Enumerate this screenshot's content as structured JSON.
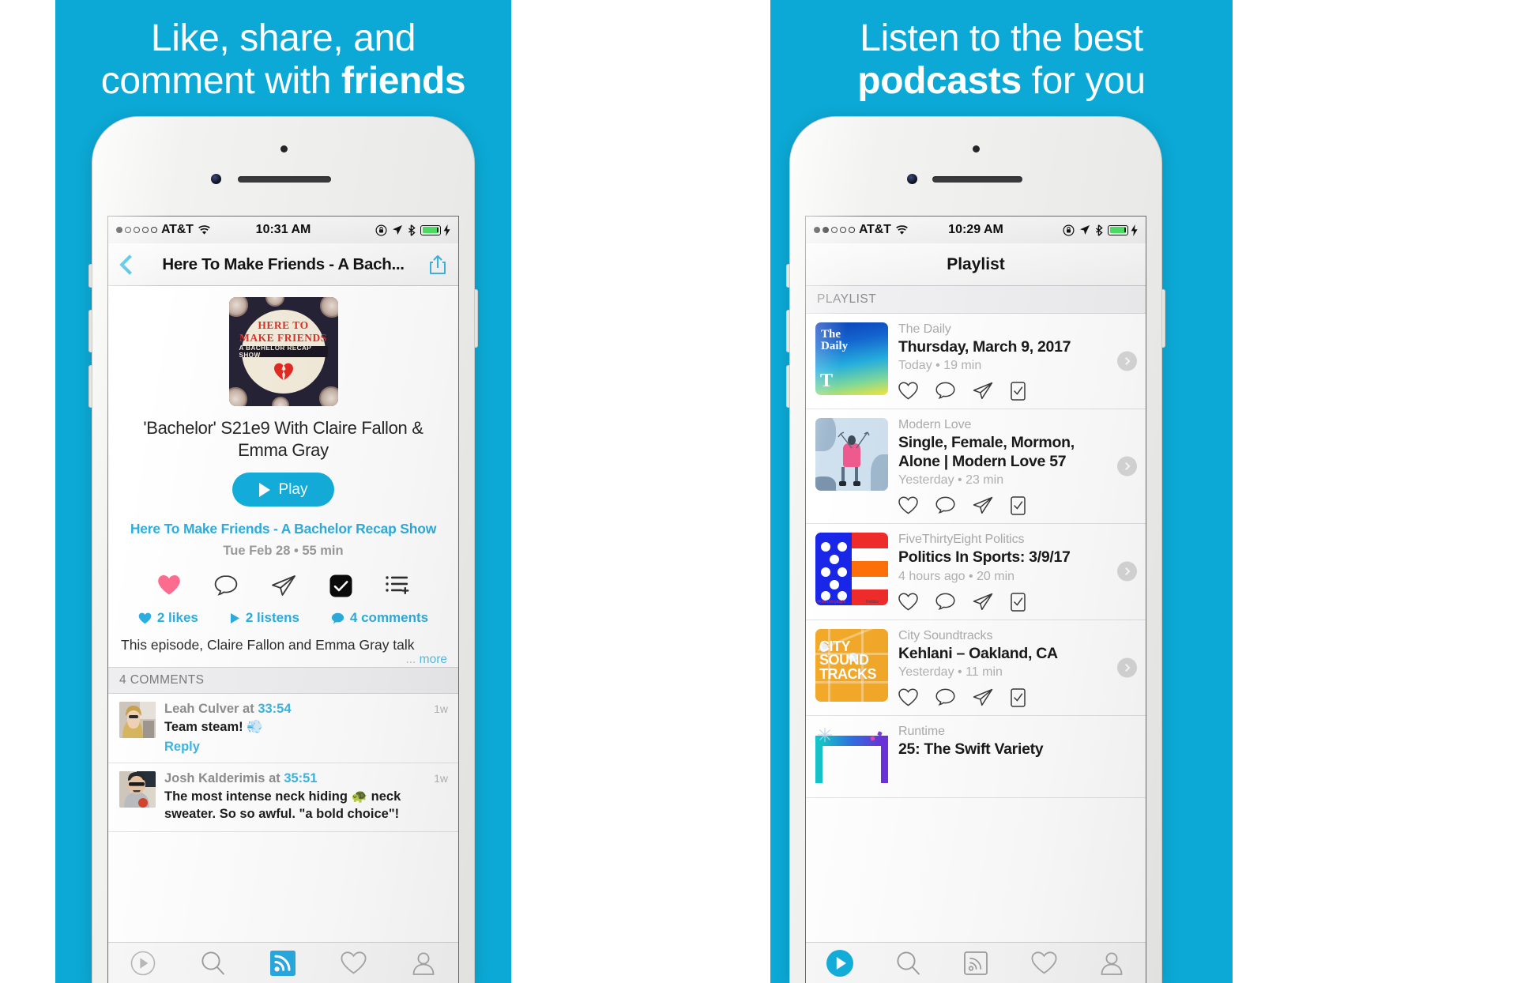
{
  "panels": {
    "left": {
      "headline_line1": "Like, share, and",
      "headline_line2_plain": "comment with ",
      "headline_line2_bold": "friends"
    },
    "right": {
      "headline_line1": "Listen to the best",
      "headline_line2_bold": "podcasts",
      "headline_line2_plain": " for you"
    }
  },
  "brand_color": "#0CA9D6",
  "accent_blue": "#13AEDC",
  "like_pink": "#FF6C8F",
  "left_phone": {
    "status": {
      "carrier": "AT&T",
      "time": "10:31 AM",
      "signal_filled": 1,
      "signal_total": 5,
      "icons": [
        "lock-rotation-icon",
        "location-icon",
        "bluetooth-icon",
        "battery-icon",
        "charging-icon"
      ]
    },
    "nav": {
      "back": "back-chevron",
      "title": "Here To Make Friends - A Bach...",
      "share": "share-icon"
    },
    "artwork": {
      "name": "here-to-make-friends-artwork",
      "line1": "HERE TO",
      "line2": "MAKE FRIENDS",
      "band": "A BACHELOR RECAP SHOW"
    },
    "episode_title": "'Bachelor' S21e9 With Claire Fallon & Emma Gray",
    "play_label": "Play",
    "show_link": "Here To Make Friends - A Bachelor Recap Show",
    "episode_meta": "Tue Feb 28 • 55 min",
    "actions": [
      "like-heart-icon",
      "comment-icon",
      "share-send-icon",
      "saved-check-icon",
      "add-to-playlist-icon"
    ],
    "stats": {
      "likes": "2 likes",
      "listens": "2 listens",
      "comments": "4 comments"
    },
    "description": "This episode, Claire Fallon and Emma Gray talk",
    "more_label": "more",
    "more_ellipsis": "...",
    "comments_header": "4 COMMENTS",
    "comments": [
      {
        "author": "Leah Culver",
        "at_label": "at",
        "timestamp": "33:54",
        "text": "Team steam! 💨",
        "age": "1w",
        "reply": "Reply"
      },
      {
        "author": "Josh Kalderimis",
        "at_label": "at",
        "timestamp": "35:51",
        "text": "The most intense neck hiding 🐢 neck sweater. So so awful. \"a bold choice\"!",
        "age": "1w",
        "reply": ""
      }
    ],
    "tabs": [
      {
        "name": "tab-player",
        "icon": "play-circle-icon",
        "active": false
      },
      {
        "name": "tab-search",
        "icon": "search-icon",
        "active": false
      },
      {
        "name": "tab-feed",
        "icon": "rss-icon",
        "active": true
      },
      {
        "name": "tab-likes",
        "icon": "heart-icon",
        "active": false
      },
      {
        "name": "tab-profile",
        "icon": "person-icon",
        "active": false
      }
    ]
  },
  "right_phone": {
    "status": {
      "carrier": "AT&T",
      "time": "10:29 AM",
      "signal_filled": 2,
      "signal_total": 5,
      "icons": [
        "lock-rotation-icon",
        "location-icon",
        "bluetooth-icon",
        "battery-icon",
        "charging-icon"
      ]
    },
    "nav": {
      "title": "Playlist"
    },
    "section_header": "PLAYLIST",
    "rows": [
      {
        "artwork": "the-daily-artwork",
        "artwork_text": "The Daily",
        "artwork_logo": "T",
        "show": "The Daily",
        "title": "Thursday, March 9, 2017",
        "meta": "Today • 19 min",
        "icons": [
          "heart-icon",
          "comment-icon",
          "share-send-icon",
          "save-device-icon"
        ]
      },
      {
        "artwork": "modern-love-artwork",
        "artwork_text": "",
        "show": "Modern Love",
        "title": "Single, Female, Mormon, Alone | Modern Love 57",
        "meta": "Yesterday • 23 min",
        "icons": [
          "heart-icon",
          "comment-icon",
          "share-send-icon",
          "save-device-icon"
        ]
      },
      {
        "artwork": "fivethirtyeight-artwork",
        "artwork_caption_left": "#FiveThirtyEight",
        "artwork_caption_right": "Politics",
        "show": "FiveThirtyEight Politics",
        "title": "Politics In Sports: 3/9/17",
        "meta": "4 hours ago • 20 min",
        "icons": [
          "heart-icon",
          "comment-icon",
          "share-send-icon",
          "save-device-icon"
        ]
      },
      {
        "artwork": "city-soundtracks-artwork",
        "artwork_text": "CITY SOUND TRACKS",
        "show": "City Soundtracks",
        "title": "Kehlani – Oakland, CA",
        "meta": "Yesterday • 11 min",
        "icons": [
          "heart-icon",
          "comment-icon",
          "share-send-icon",
          "save-device-icon"
        ]
      },
      {
        "artwork": "runtime-artwork",
        "artwork_text": "",
        "show": "Runtime",
        "title": "25: The Swift Variety",
        "meta": "",
        "icons": []
      }
    ],
    "tabs": [
      {
        "name": "tab-player",
        "icon": "play-circle-icon",
        "active": true
      },
      {
        "name": "tab-search",
        "icon": "search-icon",
        "active": false
      },
      {
        "name": "tab-feed",
        "icon": "rss-icon",
        "active": false
      },
      {
        "name": "tab-likes",
        "icon": "heart-icon",
        "active": false
      },
      {
        "name": "tab-profile",
        "icon": "person-icon",
        "active": false
      }
    ]
  }
}
